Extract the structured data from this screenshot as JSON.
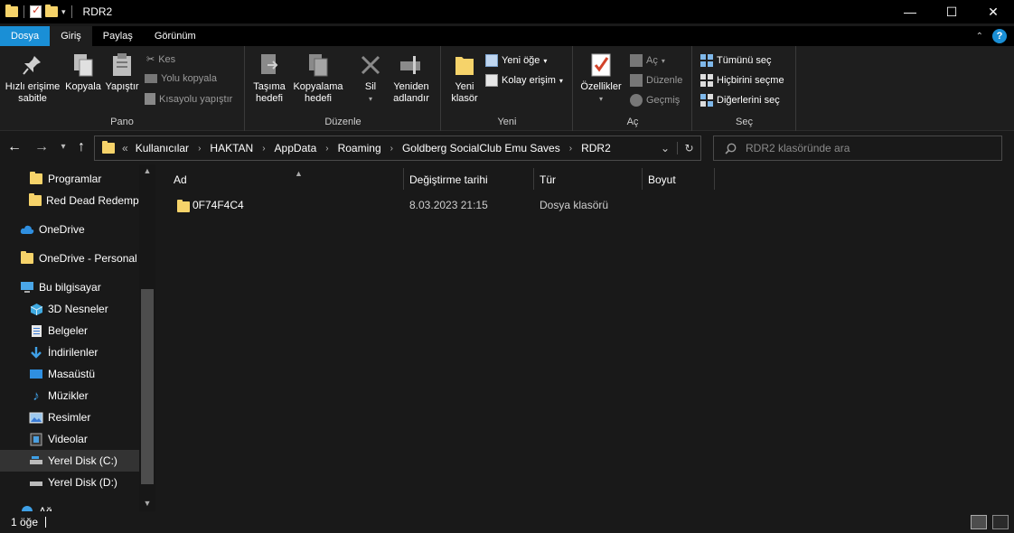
{
  "window": {
    "title": "RDR2"
  },
  "ribbon_tabs": [
    {
      "label": "Dosya"
    },
    {
      "label": "Giriş"
    },
    {
      "label": "Paylaş"
    },
    {
      "label": "Görünüm"
    }
  ],
  "ribbon": {
    "pano": {
      "label": "Pano",
      "pin": "Hızlı erişime sabitle",
      "pin_line1": "Hızlı erişime",
      "pin_line2": "sabitle",
      "copy": "Kopyala",
      "paste": "Yapıştır",
      "cut": "Kes",
      "copy_path": "Yolu kopyala",
      "paste_shortcut": "Kısayolu yapıştır"
    },
    "duzenle": {
      "label": "Düzenle",
      "move_to_line1": "Taşıma",
      "move_to_line2": "hedefi",
      "copy_to_line1": "Kopyalama",
      "copy_to_line2": "hedefi",
      "delete": "Sil",
      "rename_line1": "Yeniden",
      "rename_line2": "adlandır"
    },
    "yeni": {
      "label": "Yeni",
      "new_folder_line1": "Yeni",
      "new_folder_line2": "klasör",
      "new_item": "Yeni öğe",
      "easy_access": "Kolay erişim"
    },
    "ac": {
      "label": "Aç",
      "properties": "Özellikler",
      "open": "Aç",
      "edit": "Düzenle",
      "history": "Geçmiş"
    },
    "sec": {
      "label": "Seç",
      "select_all": "Tümünü seç",
      "select_none": "Hiçbirini seçme",
      "invert": "Diğerlerini seç"
    }
  },
  "address": {
    "prefix": "«",
    "crumbs": [
      "Kullanıcılar",
      "HAKTAN",
      "AppData",
      "Roaming",
      "Goldberg SocialClub Emu Saves",
      "RDR2"
    ]
  },
  "search": {
    "placeholder": "RDR2 klasöründe ara"
  },
  "nav": {
    "items": [
      {
        "label": "Programlar",
        "icon": "folder-icon"
      },
      {
        "label": "Red Dead Redempti",
        "icon": "folder-icon"
      },
      {
        "label": "OneDrive",
        "icon": "cloud-icon"
      },
      {
        "label": "OneDrive - Personal",
        "icon": "folder-icon"
      },
      {
        "label": "Bu bilgisayar",
        "icon": "computer-icon"
      },
      {
        "label": "3D Nesneler",
        "icon": "cube-icon"
      },
      {
        "label": "Belgeler",
        "icon": "document-icon"
      },
      {
        "label": "İndirilenler",
        "icon": "download-icon"
      },
      {
        "label": "Masaüstü",
        "icon": "desktop-icon"
      },
      {
        "label": "Müzikler",
        "icon": "music-icon"
      },
      {
        "label": "Resimler",
        "icon": "pictures-icon"
      },
      {
        "label": "Videolar",
        "icon": "video-icon"
      },
      {
        "label": "Yerel Disk (C:)",
        "icon": "drive-icon"
      },
      {
        "label": "Yerel Disk (D:)",
        "icon": "drive-icon"
      },
      {
        "label": "Ağ",
        "icon": "network-icon"
      }
    ]
  },
  "columns": [
    "Ad",
    "Değiştirme tarihi",
    "Tür",
    "Boyut"
  ],
  "files": [
    {
      "name": "0F74F4C4",
      "modified": "8.03.2023 21:15",
      "type": "Dosya klasörü",
      "size": ""
    }
  ],
  "status": {
    "count": "1 öğe"
  },
  "colors": {
    "accent": "#1a8fd6",
    "folder": "#f6d36a",
    "background": "#191919"
  }
}
